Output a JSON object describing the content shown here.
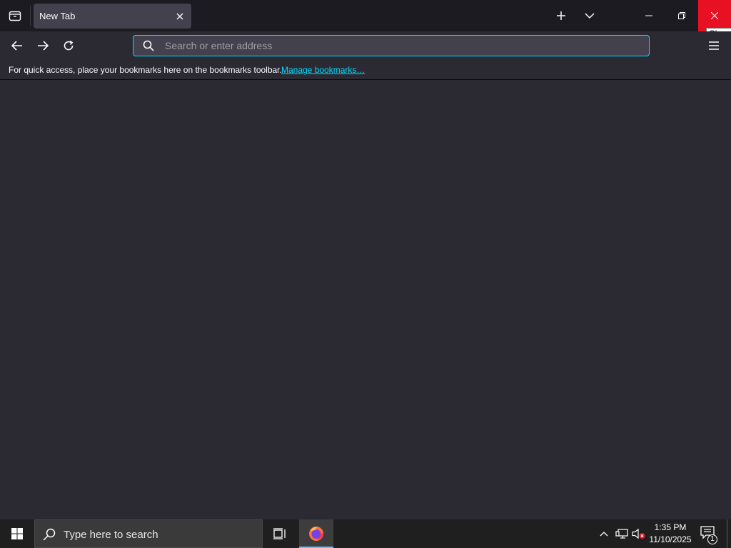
{
  "browser": {
    "tab": {
      "title": "New Tab"
    },
    "window_controls": {
      "close_tooltip": "Close"
    },
    "urlbar": {
      "placeholder": "Search or enter address",
      "value": ""
    },
    "bookmarks_bar": {
      "message": "For quick access, place your bookmarks here on the bookmarks toolbar.",
      "link": "Manage bookmarks…"
    }
  },
  "taskbar": {
    "search_placeholder": "Type here to search",
    "clock": {
      "time": "1:35 PM",
      "date": "11/10/2025"
    },
    "notifications_count": "1",
    "pinned": [
      "firefox-icon"
    ]
  },
  "colors": {
    "accent": "#00ddff",
    "close_hover": "#e81123",
    "content_bg": "#2b2a33"
  }
}
